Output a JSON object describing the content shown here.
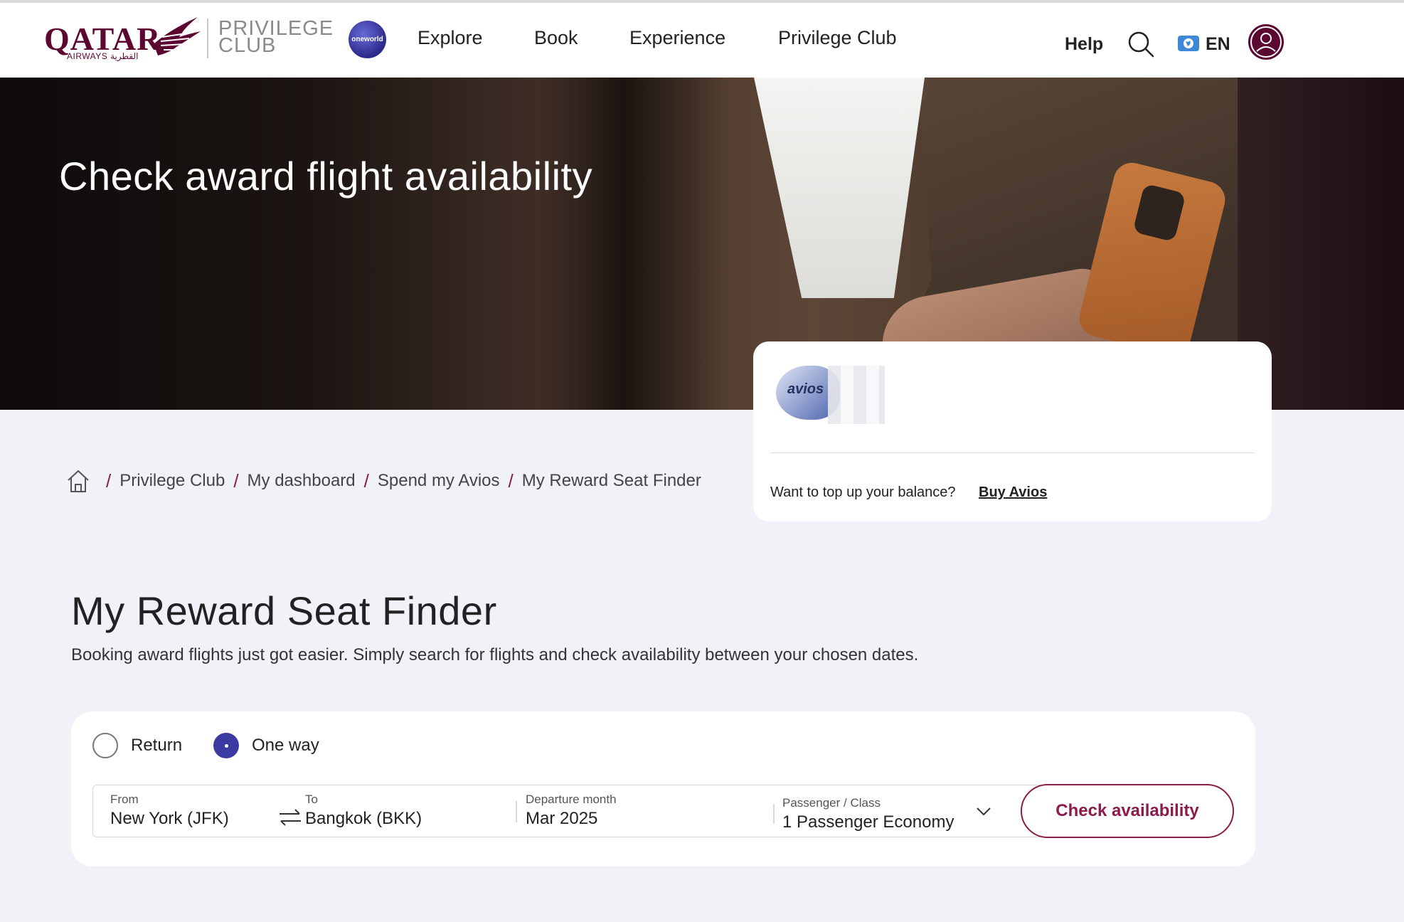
{
  "header": {
    "logo_word": "QATAR",
    "logo_sub": "AIRWAYS القطرية",
    "program_line1": "PRIVILEGE",
    "program_line2": "CLUB",
    "alliance": "oneworld",
    "nav": [
      "Explore",
      "Book",
      "Experience",
      "Privilege Club"
    ],
    "help": "Help",
    "language": "EN",
    "icons": {
      "search": "search-icon",
      "globe": "globe-icon",
      "avatar": "user-avatar-icon"
    }
  },
  "hero": {
    "title": "Check award flight availability"
  },
  "avios_card": {
    "logo_text": "avios",
    "topup_prompt": "Want to top up your balance?",
    "buy_link": "Buy Avios"
  },
  "breadcrumb": {
    "items": [
      "Privilege Club",
      "My dashboard",
      "Spend my Avios",
      "My Reward Seat Finder"
    ],
    "separator": "/"
  },
  "main": {
    "title": "My Reward Seat Finder",
    "description": "Booking award flights just got easier. Simply search for flights and check availability between your chosen dates."
  },
  "search": {
    "trip_types": [
      {
        "label": "Return",
        "selected": false
      },
      {
        "label": "One way",
        "selected": true
      }
    ],
    "from": {
      "label": "From",
      "value": "New York (JFK)"
    },
    "to": {
      "label": "To",
      "value": "Bangkok (BKK)"
    },
    "departure": {
      "label": "Departure month",
      "value": "Mar 2025"
    },
    "passenger": {
      "label": "Passenger / Class",
      "value": "1 Passenger Economy"
    },
    "submit_label": "Check availability"
  },
  "colors": {
    "brand": "#5c0632",
    "accent": "#8a1b4a",
    "radio_selected": "#3b3aa2",
    "page_bg": "#f1f2f7"
  }
}
